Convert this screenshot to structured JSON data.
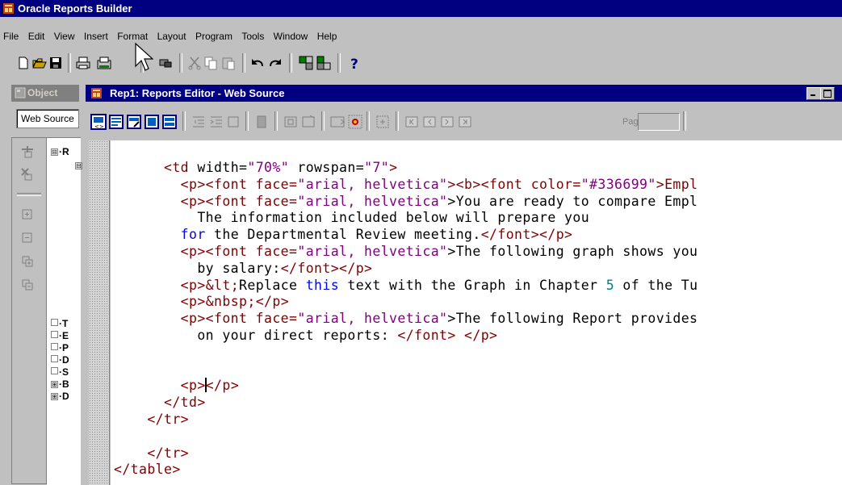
{
  "app": {
    "title": "Oracle Reports Builder"
  },
  "menu": [
    "File",
    "Edit",
    "View",
    "Insert",
    "Format",
    "Layout",
    "Program",
    "Tools",
    "Window",
    "Help"
  ],
  "toolbar_icons": [
    "new-icon",
    "open-icon",
    "save-icon",
    "print-icon",
    "print-preview-icon",
    "spellcheck-icon",
    "cut-icon",
    "copy-icon",
    "paste-icon",
    "undo-icon",
    "redo-icon",
    "run-icon",
    "compile-icon",
    "help-icon"
  ],
  "navigator": {
    "title": "Object",
    "view_select": "Web Source",
    "tree_items": [
      {
        "expander": "⊟",
        "label": "R"
      },
      {
        "expander": "⊟",
        "label": ""
      },
      {
        "expander": "",
        "label": "T"
      },
      {
        "expander": "",
        "label": "E"
      },
      {
        "expander": "",
        "label": "P"
      },
      {
        "expander": "",
        "label": "D"
      },
      {
        "expander": "",
        "label": "S"
      },
      {
        "expander": "⊞",
        "label": "B"
      },
      {
        "expander": "⊞",
        "label": "D"
      }
    ]
  },
  "editor": {
    "title": "Rep1: Reports Editor - Web Source",
    "page_label": "Page:",
    "page_value": ""
  },
  "code": {
    "l1": {
      "tag_open": "<td ",
      "a1": "width=",
      "v1": "\"70%\"",
      "a2": " rowspan=",
      "v2": "\"7\"",
      "tag_close": ">"
    },
    "l2": {
      "p_open": "<p><font face=",
      "face": "\"arial, helvetica\"",
      "mid": "><b><font color=",
      "color": "\"#336699\"",
      "rest": ">Empl"
    },
    "l3": {
      "p_open": "<p><font face=",
      "face": "\"arial, helvetica\"",
      "text": ">You are ready to compare Empl"
    },
    "l4": "The information included below will prepare you",
    "l5": {
      "kw": "for",
      "text": " the Departmental Review meeting.",
      "close": "</font></p>"
    },
    "l6": {
      "p_open": "<p><font face=",
      "face": "\"arial, helvetica\"",
      "text": ">The following graph shows you"
    },
    "l7": {
      "text": "by salary:",
      "close": "</font></p>"
    },
    "l8": {
      "p_open": "<p>",
      "ent": "&lt;",
      "t1": "Replace ",
      "kw": "this",
      "t2": " text with the Graph in Chapter ",
      "num": "5",
      "t3": " of the Tu"
    },
    "l9": {
      "p_open": "<p>",
      "ent": "&nbsp;",
      "close": "</p>"
    },
    "l10": {
      "p_open": "<p><font face=",
      "face": "\"arial, helvetica\"",
      "text": ">The following Report provides"
    },
    "l11": {
      "text": "on your direct reports: ",
      "close": "</font> </p>"
    },
    "l14a": "<p>",
    "l14b": "</p>",
    "l15": "</td>",
    "l16": "</tr>",
    "l18": "</tr>",
    "l19": "</table>"
  },
  "colors": {
    "title_bar": "#000080",
    "tag": "#800000",
    "attr_value": "#800080",
    "keyword": "#0000ff",
    "number": "#008080"
  }
}
